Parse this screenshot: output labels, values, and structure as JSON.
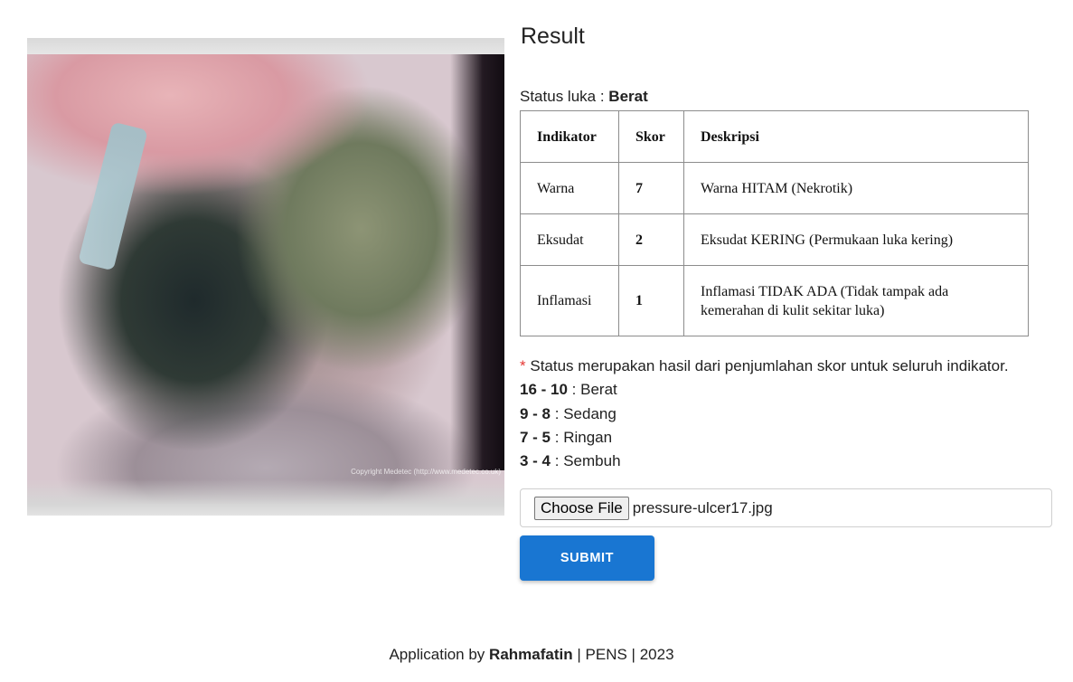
{
  "image": {
    "alt": "wound photo",
    "watermark": "Copyright Medetec (http://www.medetec.co.uk)"
  },
  "result": {
    "title": "Result",
    "status_label": "Status luka :",
    "status_value": "Berat"
  },
  "table": {
    "headers": [
      "Indikator",
      "Skor",
      "Deskripsi"
    ],
    "rows": [
      {
        "indikator": "Warna",
        "skor": "7",
        "deskripsi": "Warna HITAM (Nekrotik)"
      },
      {
        "indikator": "Eksudat",
        "skor": "2",
        "deskripsi": "Eksudat KERING (Permukaan luka kering)"
      },
      {
        "indikator": "Inflamasi",
        "skor": "1",
        "deskripsi": "Inflamasi TIDAK ADA (Tidak tampak ada kemerahan di kulit sekitar luka)"
      }
    ]
  },
  "notes": {
    "asterisk": "*",
    "text": "Status merupakan hasil dari penjumlahan skor untuk seluruh indikator.",
    "ranges": [
      {
        "range": "16 - 10",
        "label": ": Berat"
      },
      {
        "range": "9 - 8",
        "label": ": Sedang"
      },
      {
        "range": "7 - 5",
        "label": ": Ringan"
      },
      {
        "range": "3 - 4",
        "label": ": Sembuh"
      }
    ]
  },
  "form": {
    "choose_file_label": "Choose File",
    "file_name": "pressure-ulcer17.jpg",
    "submit_label": "SUBMIT"
  },
  "footer": {
    "prefix": "Application by",
    "author": "Rahmafatin",
    "sep1": "|",
    "org": "PENS",
    "sep2": "|",
    "year": "2023"
  },
  "colors": {
    "primary": "#1976d2",
    "asterisk": "#e53935",
    "border": "#8c8c8c"
  }
}
